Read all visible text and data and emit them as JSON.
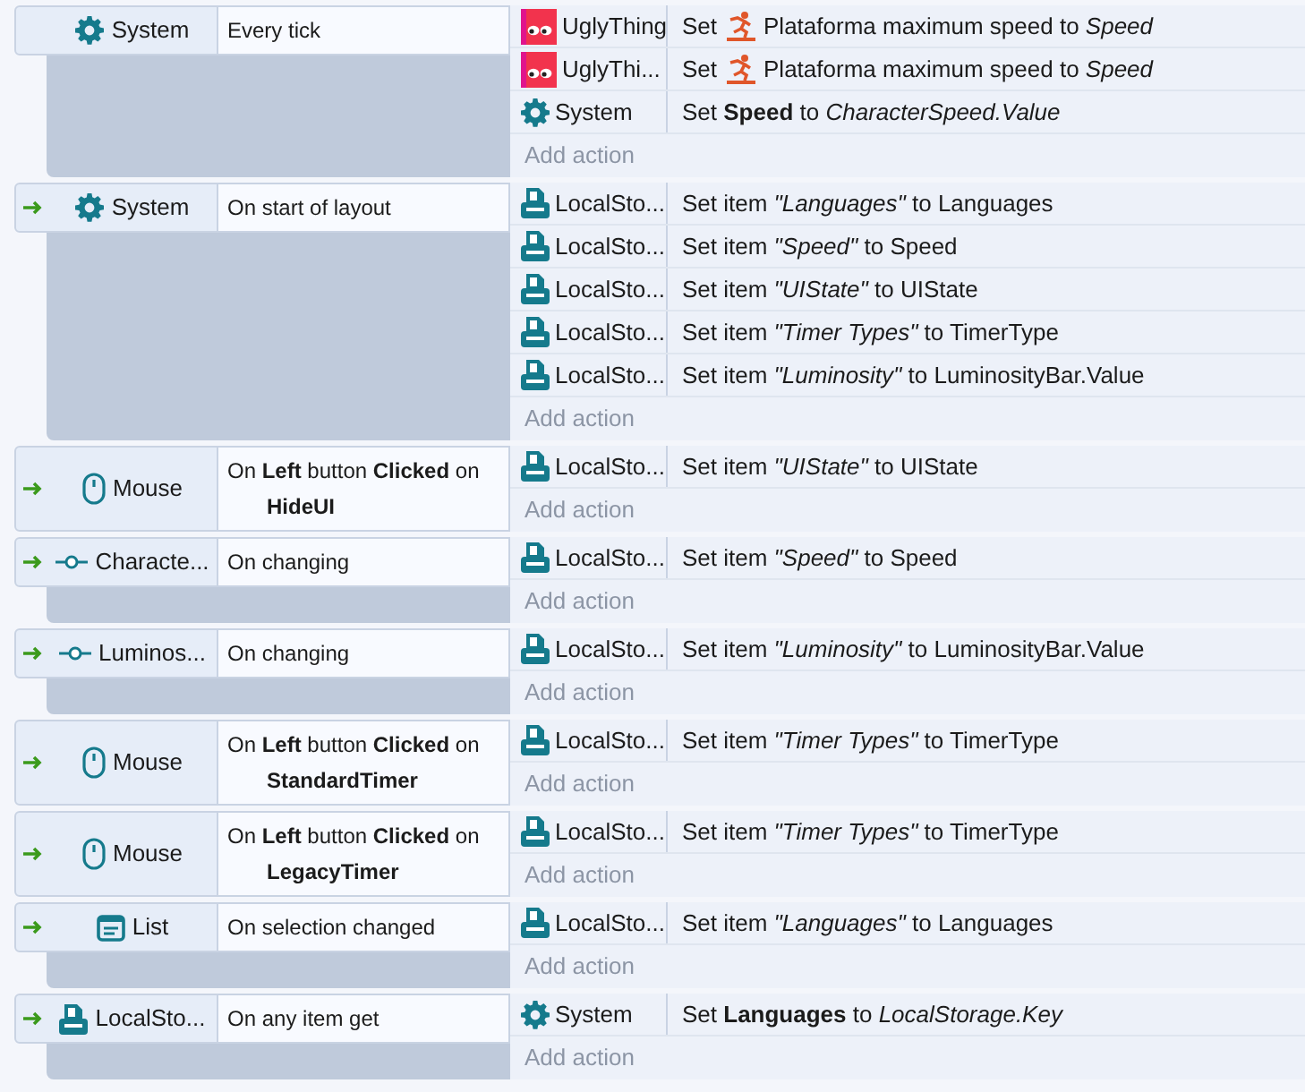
{
  "events": [
    {
      "trigger": false,
      "condition": {
        "kind": "system",
        "object": "System",
        "text": "Every tick"
      },
      "actions": [
        {
          "kind": "sprite",
          "object": "UglyThing",
          "verb": "Set",
          "has_behavior": true,
          "text": "Plataforma maximum speed to *Speed*"
        },
        {
          "kind": "sprite",
          "object": "UglyThi...",
          "verb": "Set",
          "has_behavior": true,
          "text": "Plataforma maximum speed to *Speed*"
        },
        {
          "kind": "system",
          "object": "System",
          "text": "Set **Speed** to *CharacterSpeed.Value*"
        }
      ],
      "add_action": "Add action"
    },
    {
      "trigger": true,
      "condition": {
        "kind": "system",
        "object": "System",
        "text": "On start of layout"
      },
      "actions": [
        {
          "kind": "storage",
          "object": "LocalSto...",
          "text": "Set item *\"Languages\"* to Languages"
        },
        {
          "kind": "storage",
          "object": "LocalSto...",
          "text": "Set item *\"Speed\"* to Speed"
        },
        {
          "kind": "storage",
          "object": "LocalSto...",
          "text": "Set item *\"UIState\"* to UIState"
        },
        {
          "kind": "storage",
          "object": "LocalSto...",
          "text": "Set item *\"Timer Types\"* to TimerType"
        },
        {
          "kind": "storage",
          "object": "LocalSto...",
          "text": "Set item *\"Luminosity\"* to LuminosityBar.Value"
        }
      ],
      "add_action": "Add action"
    },
    {
      "trigger": true,
      "condition": {
        "kind": "mouse",
        "object": "Mouse",
        "text": "On **Left** button **Clicked** on **HideUI**"
      },
      "actions": [
        {
          "kind": "storage",
          "object": "LocalSto...",
          "text": "Set item *\"UIState\"* to UIState"
        }
      ],
      "add_action": "Add action"
    },
    {
      "trigger": true,
      "condition": {
        "kind": "slider",
        "object": "Characte...",
        "text": "On changing"
      },
      "actions": [
        {
          "kind": "storage",
          "object": "LocalSto...",
          "text": "Set item *\"Speed\"* to Speed"
        }
      ],
      "add_action": "Add action"
    },
    {
      "trigger": true,
      "condition": {
        "kind": "slider",
        "object": "Luminos...",
        "text": "On changing"
      },
      "actions": [
        {
          "kind": "storage",
          "object": "LocalSto...",
          "text": "Set item *\"Luminosity\"* to LuminosityBar.Value"
        }
      ],
      "add_action": "Add action"
    },
    {
      "trigger": true,
      "condition": {
        "kind": "mouse",
        "object": "Mouse",
        "text": "On **Left** button **Clicked** on **StandardTimer**"
      },
      "actions": [
        {
          "kind": "storage",
          "object": "LocalSto...",
          "text": "Set item *\"Timer Types\"* to TimerType"
        }
      ],
      "add_action": "Add action"
    },
    {
      "trigger": true,
      "condition": {
        "kind": "mouse",
        "object": "Mouse",
        "text": "On **Left** button **Clicked** on **LegacyTimer**"
      },
      "actions": [
        {
          "kind": "storage",
          "object": "LocalSto...",
          "text": "Set item *\"Timer Types\"* to TimerType"
        }
      ],
      "add_action": "Add action"
    },
    {
      "trigger": true,
      "condition": {
        "kind": "list",
        "object": "List",
        "text": "On selection changed"
      },
      "actions": [
        {
          "kind": "storage",
          "object": "LocalSto...",
          "text": "Set item *\"Languages\"* to Languages"
        }
      ],
      "add_action": "Add action"
    },
    {
      "trigger": true,
      "condition": {
        "kind": "storage",
        "object": "LocalSto...",
        "text": "On any item get"
      },
      "actions": [
        {
          "kind": "system",
          "object": "System",
          "text": "Set **Languages** to *LocalStorage.Key*"
        }
      ],
      "add_action": "Add action"
    }
  ]
}
